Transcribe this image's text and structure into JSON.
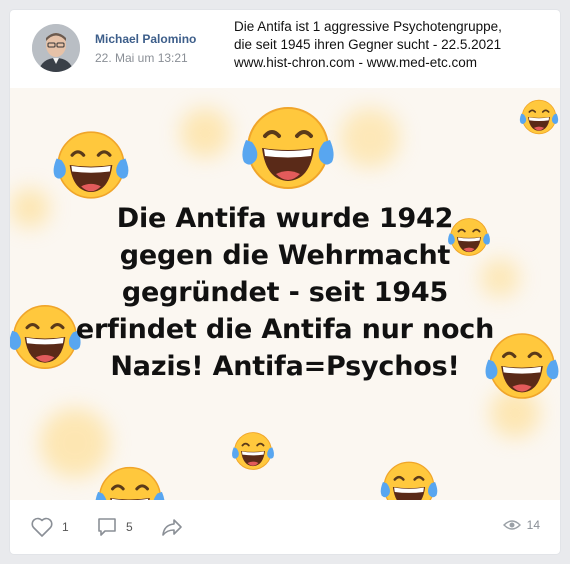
{
  "post": {
    "author": "Michael Palomino",
    "timestamp": "22. Mai um 13:21",
    "text_lines": [
      "Die Antifa ist 1 aggressive Psychotengruppe,",
      "die seit 1945 ihren Gegner sucht - 22.5.2021",
      "www.hist-chron.com - www.med-etc.com"
    ]
  },
  "image": {
    "caption_lines": [
      "Die Antifa wurde 1942",
      "gegen die Wehrmacht",
      "gegründet - seit 1945",
      "erfindet die Antifa nur noch",
      "Nazis! Antifa=Psychos!"
    ],
    "emoji_icon": "face-with-tears-of-joy-icon"
  },
  "footer": {
    "likes": "1",
    "comments": "5",
    "views": "14"
  },
  "colors": {
    "author": "#3d5e8a",
    "emoji_face": "#ffc83d",
    "tears": "#58a6f0",
    "background": "#e9eaed"
  }
}
